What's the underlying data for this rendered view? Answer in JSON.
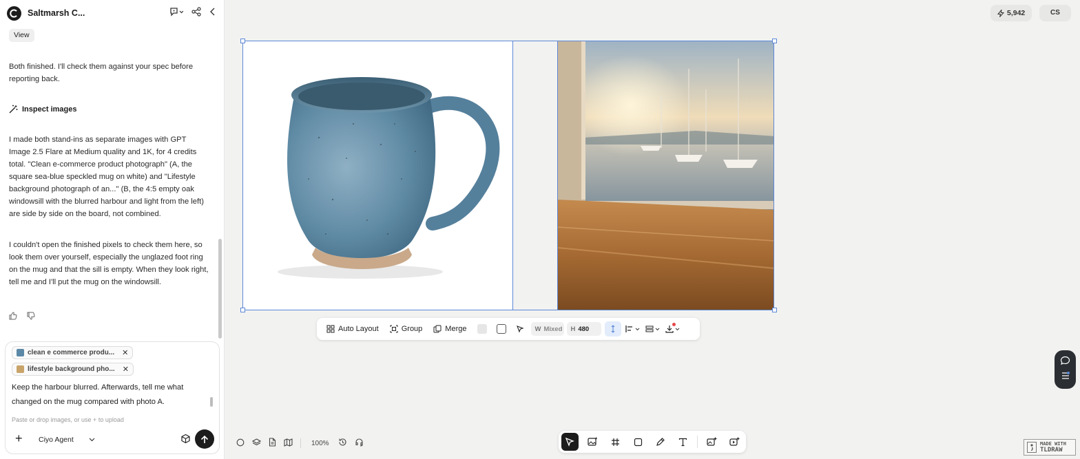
{
  "header": {
    "project_title": "Saltmarsh C..."
  },
  "chat": {
    "view_label": "View",
    "msg_status": "Both finished. I'll check them against your spec before reporting back.",
    "inspect_label": "Inspect images",
    "msg_summary": "I made both stand-ins as separate images with GPT Image 2.5 Flare at Medium quality and 1K, for 4 credits total. \"Clean e-commerce product photograph\" (A, the square sea-blue speckled mug on white) and \"Lifestyle background photograph of an...\" (B, the 4:5 empty oak windowsill with the blurred harbour and light from the left) are side by side on the board, not combined.",
    "msg_check": "I couldn't open the finished pixels to check them here, so look them over yourself, especially the unglazed foot ring on the mug and that the sill is empty. When they look right, tell me and I'll put the mug on the windowsill."
  },
  "composer": {
    "attachments": [
      {
        "label": "clean e commerce produ...",
        "thumb_color": "#5b88a6"
      },
      {
        "label": "lifestyle background pho...",
        "thumb_color": "#c9a46a"
      }
    ],
    "text": "Keep the harbour blurred. Afterwards, tell me what changed on the mug compared with photo A.",
    "hint": "Paste or drop images, or use + to upload",
    "agent_label": "Ciyo Agent"
  },
  "topbar": {
    "credits": "5,942",
    "avatar": "CS"
  },
  "toolbar": {
    "auto_layout": "Auto Layout",
    "group": "Group",
    "merge": "Merge",
    "w_label": "W",
    "w_value": "Mixed",
    "h_label": "H",
    "h_value": "480"
  },
  "bottom": {
    "zoom": "100%"
  },
  "branding": {
    "line1": "MADE WITH",
    "line2": "TLDRAW"
  },
  "colors": {
    "accent_selection": "#5b88d6",
    "dark": "#1c1c1c",
    "canvas_bg": "#f2f2f1"
  }
}
